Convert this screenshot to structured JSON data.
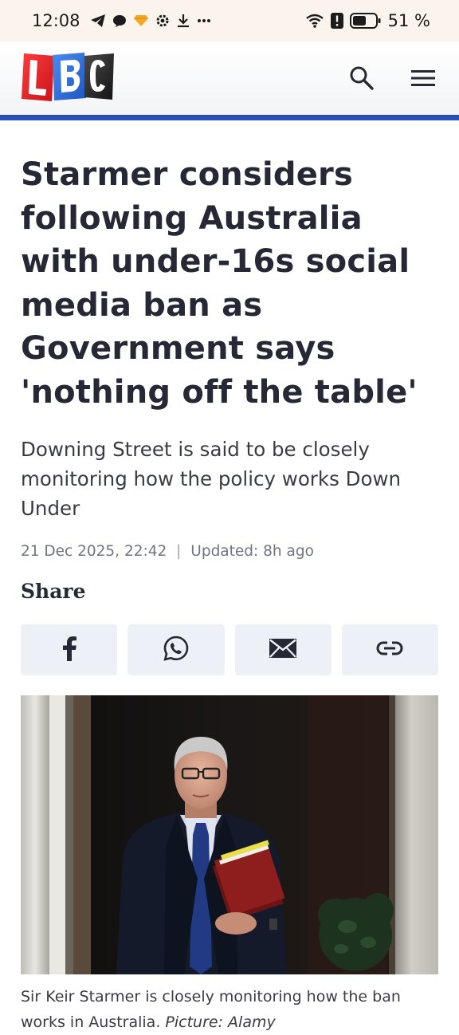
{
  "status_bar": {
    "time": "12:08",
    "battery": "51 %",
    "left_icons": [
      "telegram-icon",
      "chat-bubble-icon",
      "diamond-icon",
      "settings-icon",
      "download-icon",
      "more-icon"
    ],
    "right_icons": [
      "wifi-icon",
      "alert-icon",
      "battery-icon"
    ]
  },
  "header": {
    "logo_text": "LBC",
    "logo_colors": [
      "#e3242b",
      "#2e6dd9",
      "#262626"
    ],
    "accent_color": "#2a50b6",
    "icons": [
      "search-icon",
      "hamburger-menu-icon"
    ]
  },
  "article": {
    "headline": "Starmer considers following Australia with under-16s social media ban as Government says 'nothing off the table'",
    "standfirst": "Downing Street is said to be closely monitoring how the policy works Down Under",
    "published": "21 Dec 2025, 22:42",
    "separator": "|",
    "updated": "Updated: 8h ago",
    "share_label": "Share",
    "share_buttons": [
      "facebook-icon",
      "whatsapp-icon",
      "email-icon",
      "copy-link-icon"
    ],
    "caption_text": "Sir Keir Starmer is closely monitoring how the ban works in Australia.",
    "caption_credit": "Picture: Alamy"
  }
}
